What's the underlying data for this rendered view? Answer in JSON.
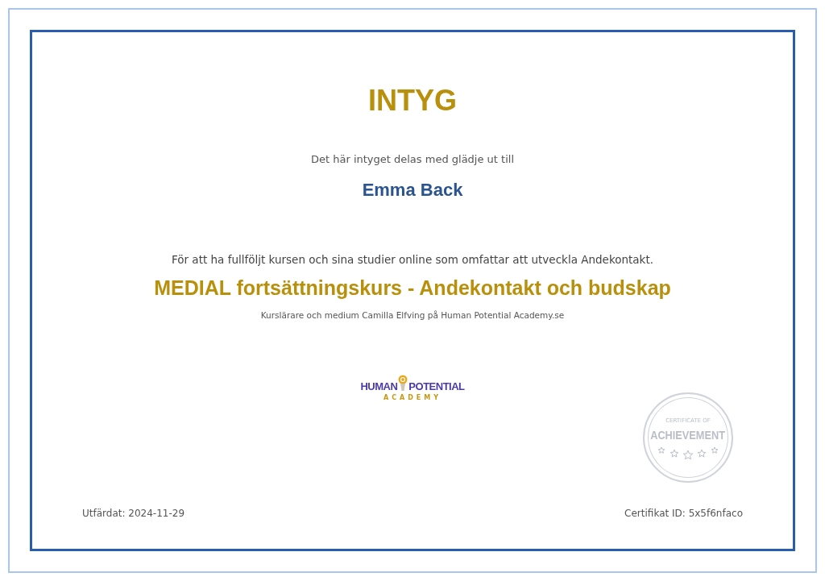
{
  "title": "INTYG",
  "intro": "Det här intyget delas med glädje ut till",
  "recipient": "Emma Back",
  "statement": "För att ha fullföljt kursen och sina studier online som omfattar att utveckla Andekontakt.",
  "course": "MEDIAL fortsättningskurs - Andekontakt och budskap",
  "instructor": "Kurslärare och medium Camilla Elfving på Human Potential Academy.se",
  "logo": {
    "word_1": "HUMAN",
    "word_2": "POTENTIAL",
    "tagline": "ACADEMY"
  },
  "seal": {
    "line_1": "CERTIFICATE OF",
    "line_2": "ACHIEVEMENT"
  },
  "footer": {
    "issued": "Utfärdat: 2024-11-29",
    "certificate_id": "Certifikat ID: 5x5f6nfaco"
  }
}
